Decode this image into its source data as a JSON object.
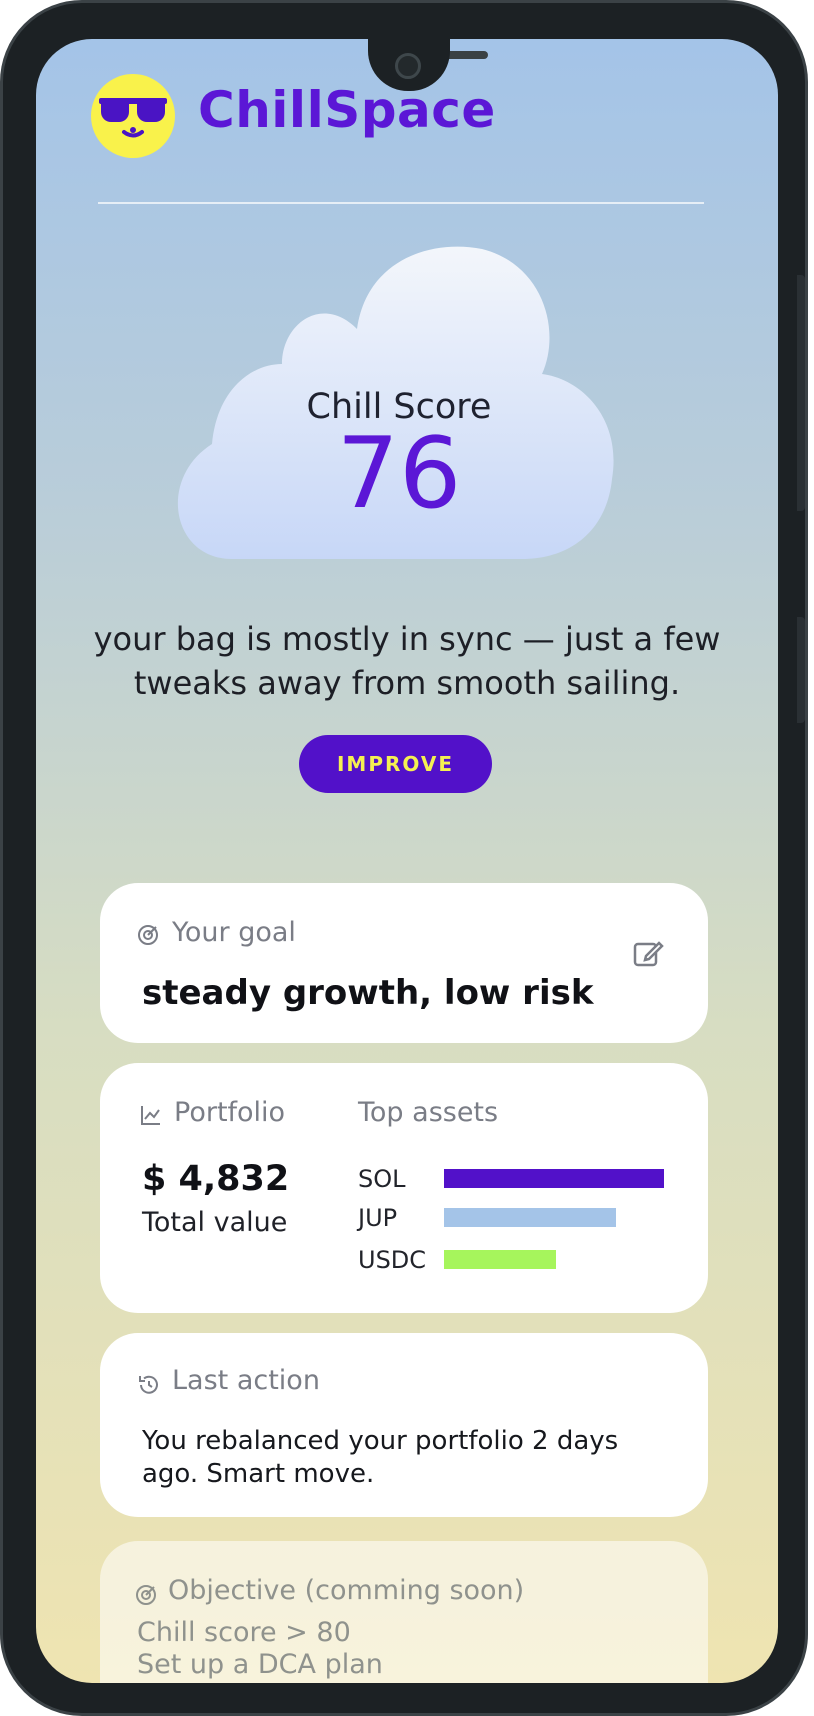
{
  "app": {
    "name": "ChillSpace"
  },
  "score": {
    "label": "Chill Score",
    "value": "76"
  },
  "tagline": "your bag is mostly in sync — just a few tweaks away from smooth sailing.",
  "improve_label": "IMPROVE",
  "goal": {
    "label": "Your goal",
    "value": "steady growth, low risk"
  },
  "portfolio": {
    "label": "Portfolio",
    "total": "$ 4,832",
    "total_label": "Total value",
    "top_assets_label": "Top assets",
    "assets": [
      {
        "name": "SOL",
        "share": 1.0,
        "color": "#5211c9"
      },
      {
        "name": "JUP",
        "share": 0.78,
        "color": "#a4c4e8"
      },
      {
        "name": "USDC",
        "share": 0.51,
        "color": "#a6f55c"
      }
    ]
  },
  "last_action": {
    "label": "Last action",
    "text": "You rebalanced your portfolio 2 days ago. Smart move."
  },
  "objective": {
    "label": "Objective (comming soon)",
    "items": [
      "Chill score > 80",
      "Set up a DCA plan"
    ]
  },
  "colors": {
    "accent": "#5b17d6",
    "logo": "#f9f24b",
    "button_text": "#f4f052"
  }
}
